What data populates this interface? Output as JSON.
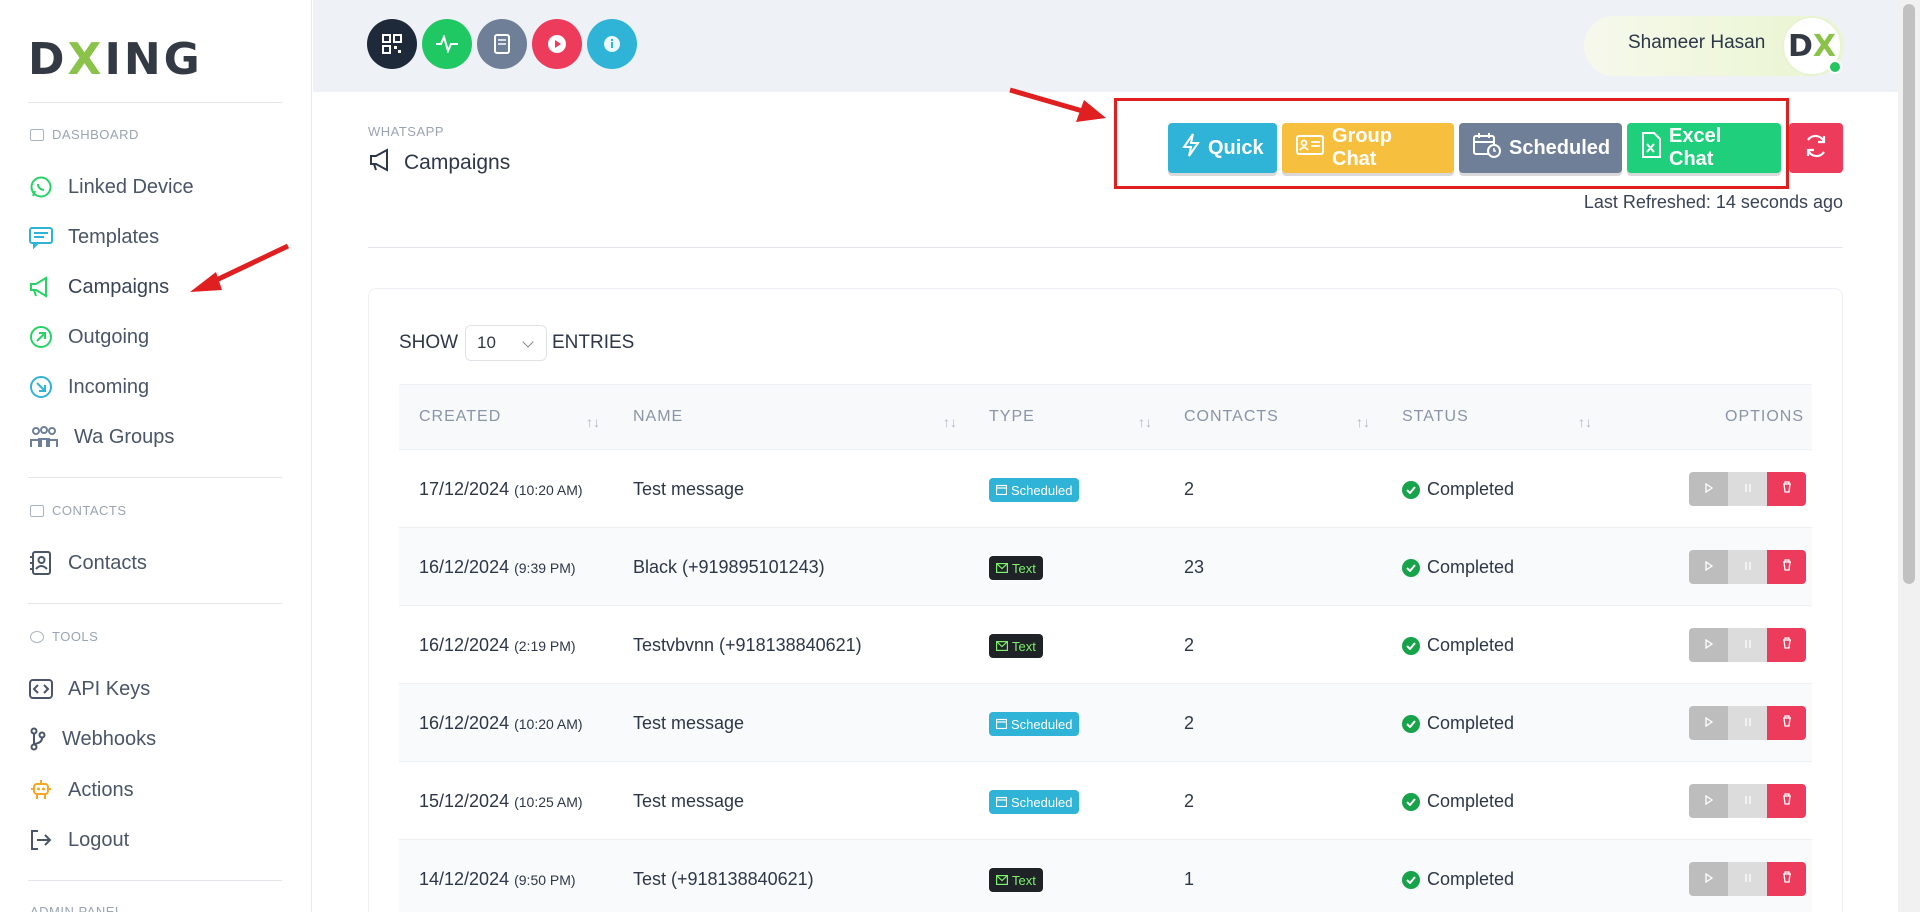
{
  "brand": {
    "logo_pre": "D",
    "logo_x": "X",
    "logo_post": "ING"
  },
  "sidebar": {
    "section_dashboard": "DASHBOARD",
    "section_contacts": "CONTACTS",
    "section_tools": "TOOLS",
    "section_admin": "ADMIN PANEL",
    "items": [
      {
        "label": "Linked Device",
        "icon": "whatsapp-icon"
      },
      {
        "label": "Templates",
        "icon": "message-template-icon"
      },
      {
        "label": "Campaigns",
        "icon": "megaphone-icon"
      },
      {
        "label": "Outgoing",
        "icon": "arrow-up-right-icon"
      },
      {
        "label": "Incoming",
        "icon": "arrow-down-right-icon"
      },
      {
        "label": "Wa Groups",
        "icon": "group-icon"
      },
      {
        "label": "Contacts",
        "icon": "contact-book-icon"
      },
      {
        "label": "API Keys",
        "icon": "code-icon"
      },
      {
        "label": "Webhooks",
        "icon": "branch-icon"
      },
      {
        "label": "Actions",
        "icon": "robot-icon"
      },
      {
        "label": "Logout",
        "icon": "logout-icon"
      }
    ]
  },
  "header": {
    "user_name": "Shameer Hasan",
    "avatar_pre": "D",
    "avatar_x": "X",
    "icon_buttons": [
      "qr-code-icon",
      "pulse-icon",
      "book-icon",
      "play-icon",
      "info-icon"
    ]
  },
  "page": {
    "breadcrumb": "WHATSAPP",
    "title": "Campaigns",
    "actions": {
      "quick": "Quick",
      "group_chat": "Group Chat",
      "scheduled": "Scheduled",
      "excel_chat": "Excel Chat"
    },
    "last_refreshed": "Last Refreshed: 14 seconds ago"
  },
  "colors": {
    "quick": "#2fb3d6",
    "group_chat": "#f6bf3e",
    "scheduled": "#6f7f97",
    "excel_chat": "#1fcf7c",
    "refresh": "#ec3b5b"
  },
  "table": {
    "show_label": "SHOW",
    "entries_value": "10",
    "entries_label": "ENTRIES",
    "columns": [
      "CREATED",
      "NAME",
      "TYPE",
      "CONTACTS",
      "STATUS",
      "OPTIONS"
    ],
    "rows": [
      {
        "date": "17/12/2024",
        "time": "(10:20 AM)",
        "name": "Test message",
        "type": "Scheduled",
        "contacts": "2",
        "status": "Completed"
      },
      {
        "date": "16/12/2024",
        "time": "(9:39 PM)",
        "name": "Black (+919895101243)",
        "type": "Text",
        "contacts": "23",
        "status": "Completed"
      },
      {
        "date": "16/12/2024",
        "time": "(2:19 PM)",
        "name": "Testvbvnn (+918138840621)",
        "type": "Text",
        "contacts": "2",
        "status": "Completed"
      },
      {
        "date": "16/12/2024",
        "time": "(10:20 AM)",
        "name": "Test message",
        "type": "Scheduled",
        "contacts": "2",
        "status": "Completed"
      },
      {
        "date": "15/12/2024",
        "time": "(10:25 AM)",
        "name": "Test message",
        "type": "Scheduled",
        "contacts": "2",
        "status": "Completed"
      },
      {
        "date": "14/12/2024",
        "time": "(9:50 PM)",
        "name": "Test (+918138840621)",
        "type": "Text",
        "contacts": "1",
        "status": "Completed"
      }
    ]
  }
}
